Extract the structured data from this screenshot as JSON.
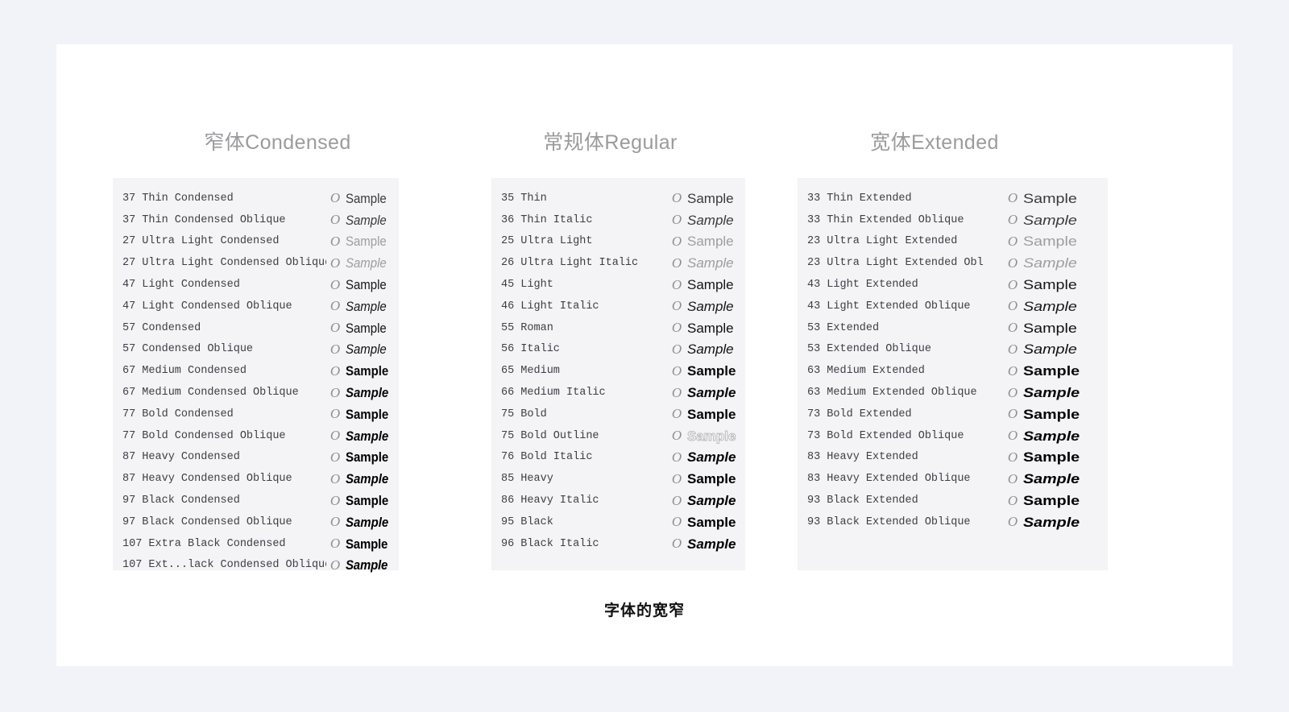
{
  "caption": "字体的宽窄",
  "glyph": "O",
  "colors": {
    "page_background": "#f2f3f8",
    "card_background": "#ffffff",
    "panel_background": "#f4f3f5",
    "heading": "#9b9b9e",
    "label": "#3c3f46",
    "glyph": "#8e8e93",
    "caption": "#111111"
  },
  "columns": [
    {
      "heading": "窄体Condensed",
      "rows": [
        {
          "number": "37",
          "name": "Thin Condensed",
          "sample": "Sample",
          "weight": "w-thin",
          "style": "",
          "width": "d-condensed"
        },
        {
          "number": "37",
          "name": "Thin Condensed Oblique",
          "sample": "Sample",
          "weight": "w-thin",
          "style": "s-italic",
          "width": "d-condensed"
        },
        {
          "number": "27",
          "name": "Ultra Light Condensed",
          "sample": "Sample",
          "weight": "w-ultra",
          "style": "",
          "width": "d-condensed"
        },
        {
          "number": "27",
          "name": "Ultra Light Condensed Oblique",
          "sample": "Sample",
          "weight": "w-ultra",
          "style": "s-italic",
          "width": "d-condensed"
        },
        {
          "number": "47",
          "name": "Light Condensed",
          "sample": "Sample",
          "weight": "w-light",
          "style": "",
          "width": "d-condensed"
        },
        {
          "number": "47",
          "name": "Light Condensed Oblique",
          "sample": "Sample",
          "weight": "w-light",
          "style": "s-italic",
          "width": "d-condensed"
        },
        {
          "number": "57",
          "name": "Condensed",
          "sample": "Sample",
          "weight": "w-regular",
          "style": "",
          "width": "d-condensed"
        },
        {
          "number": "57",
          "name": "Condensed Oblique",
          "sample": "Sample",
          "weight": "w-regular",
          "style": "s-italic",
          "width": "d-condensed"
        },
        {
          "number": "67",
          "name": "Medium Condensed",
          "sample": "Sample",
          "weight": "w-medium",
          "style": "",
          "width": "d-condensed"
        },
        {
          "number": "67",
          "name": "Medium Condensed Oblique",
          "sample": "Sample",
          "weight": "w-medium",
          "style": "s-italic",
          "width": "d-condensed"
        },
        {
          "number": "77",
          "name": "Bold Condensed",
          "sample": "Sample",
          "weight": "w-bold",
          "style": "",
          "width": "d-condensed"
        },
        {
          "number": "77",
          "name": "Bold Condensed Oblique",
          "sample": "Sample",
          "weight": "w-bold",
          "style": "s-italic",
          "width": "d-condensed"
        },
        {
          "number": "87",
          "name": "Heavy Condensed",
          "sample": "Sample",
          "weight": "w-heavy",
          "style": "",
          "width": "d-condensed"
        },
        {
          "number": "87",
          "name": "Heavy Condensed Oblique",
          "sample": "Sample",
          "weight": "w-heavy",
          "style": "s-italic",
          "width": "d-condensed"
        },
        {
          "number": "97",
          "name": "Black Condensed",
          "sample": "Sample",
          "weight": "w-black",
          "style": "",
          "width": "d-condensed"
        },
        {
          "number": "97",
          "name": "Black Condensed Oblique",
          "sample": "Sample",
          "weight": "w-black",
          "style": "s-italic",
          "width": "d-condensed"
        },
        {
          "number": "107",
          "name": "Extra Black Condensed",
          "sample": "Sample",
          "weight": "w-extrablack",
          "style": "",
          "width": "d-condensed"
        },
        {
          "number": "107",
          "name": "Ext...lack Condensed Oblique",
          "sample": "Sample",
          "weight": "w-extrablack",
          "style": "s-italic",
          "width": "d-condensed"
        }
      ]
    },
    {
      "heading": "常规体Regular",
      "rows": [
        {
          "number": "35",
          "name": "Thin",
          "sample": "Sample",
          "weight": "w-thin",
          "style": "",
          "width": ""
        },
        {
          "number": "36",
          "name": "Thin Italic",
          "sample": "Sample",
          "weight": "w-thin",
          "style": "s-italic",
          "width": ""
        },
        {
          "number": "25",
          "name": "Ultra Light",
          "sample": "Sample",
          "weight": "w-ultra",
          "style": "",
          "width": ""
        },
        {
          "number": "26",
          "name": "Ultra Light Italic",
          "sample": "Sample",
          "weight": "w-ultra",
          "style": "s-italic",
          "width": ""
        },
        {
          "number": "45",
          "name": "Light",
          "sample": "Sample",
          "weight": "w-light",
          "style": "",
          "width": ""
        },
        {
          "number": "46",
          "name": "Light Italic",
          "sample": "Sample",
          "weight": "w-light",
          "style": "s-italic",
          "width": ""
        },
        {
          "number": "55",
          "name": "Roman",
          "sample": "Sample",
          "weight": "w-regular",
          "style": "",
          "width": ""
        },
        {
          "number": "56",
          "name": "Italic",
          "sample": "Sample",
          "weight": "w-regular",
          "style": "s-italic",
          "width": ""
        },
        {
          "number": "65",
          "name": "Medium",
          "sample": "Sample",
          "weight": "w-medium",
          "style": "",
          "width": ""
        },
        {
          "number": "66",
          "name": "Medium Italic",
          "sample": "Sample",
          "weight": "w-medium",
          "style": "s-italic",
          "width": ""
        },
        {
          "number": "75",
          "name": "Bold",
          "sample": "Sample",
          "weight": "w-bold",
          "style": "",
          "width": ""
        },
        {
          "number": "75",
          "name": "Bold Outline",
          "sample": "Sample",
          "weight": "d-outline",
          "style": "",
          "width": ""
        },
        {
          "number": "76",
          "name": "Bold Italic",
          "sample": "Sample",
          "weight": "w-bold",
          "style": "s-italic",
          "width": ""
        },
        {
          "number": "85",
          "name": "Heavy",
          "sample": "Sample",
          "weight": "w-heavy",
          "style": "",
          "width": ""
        },
        {
          "number": "86",
          "name": "Heavy Italic",
          "sample": "Sample",
          "weight": "w-heavy",
          "style": "s-italic",
          "width": ""
        },
        {
          "number": "95",
          "name": "Black",
          "sample": "Sample",
          "weight": "w-black",
          "style": "",
          "width": ""
        },
        {
          "number": "96",
          "name": "Black Italic",
          "sample": "Sample",
          "weight": "w-black",
          "style": "s-italic",
          "width": ""
        }
      ]
    },
    {
      "heading": "宽体Extended",
      "rows": [
        {
          "number": "33",
          "name": "Thin Extended",
          "sample": "Sample",
          "weight": "w-thin",
          "style": "",
          "width": "d-extended"
        },
        {
          "number": "33",
          "name": "Thin Extended Oblique",
          "sample": "Sample",
          "weight": "w-thin",
          "style": "s-italic",
          "width": "d-extended"
        },
        {
          "number": "23",
          "name": "Ultra Light Extended",
          "sample": "Sample",
          "weight": "w-ultra",
          "style": "",
          "width": "d-extended"
        },
        {
          "number": "23",
          "name": "Ultra Light Extended Obl",
          "sample": "Sample",
          "weight": "w-ultra",
          "style": "s-italic",
          "width": "d-extended"
        },
        {
          "number": "43",
          "name": "Light Extended",
          "sample": "Sample",
          "weight": "w-light",
          "style": "",
          "width": "d-extended"
        },
        {
          "number": "43",
          "name": "Light Extended Oblique",
          "sample": "Sample",
          "weight": "w-light",
          "style": "s-italic",
          "width": "d-extended"
        },
        {
          "number": "53",
          "name": "Extended",
          "sample": "Sample",
          "weight": "w-regular",
          "style": "",
          "width": "d-extended"
        },
        {
          "number": "53",
          "name": "Extended Oblique",
          "sample": "Sample",
          "weight": "w-regular",
          "style": "s-italic",
          "width": "d-extended"
        },
        {
          "number": "63",
          "name": "Medium Extended",
          "sample": "Sample",
          "weight": "w-medium",
          "style": "",
          "width": "d-extended"
        },
        {
          "number": "63",
          "name": "Medium Extended Oblique",
          "sample": "Sample",
          "weight": "w-medium",
          "style": "s-italic",
          "width": "d-extended"
        },
        {
          "number": "73",
          "name": "Bold Extended",
          "sample": "Sample",
          "weight": "w-bold",
          "style": "",
          "width": "d-extended"
        },
        {
          "number": "73",
          "name": "Bold Extended Oblique",
          "sample": "Sample",
          "weight": "w-bold",
          "style": "s-italic",
          "width": "d-extended"
        },
        {
          "number": "83",
          "name": "Heavy Extended",
          "sample": "Sample",
          "weight": "w-heavy",
          "style": "",
          "width": "d-extended"
        },
        {
          "number": "83",
          "name": "Heavy Extended Oblique",
          "sample": "Sample",
          "weight": "w-heavy",
          "style": "s-italic",
          "width": "d-extended"
        },
        {
          "number": "93",
          "name": "Black Extended",
          "sample": "Sample",
          "weight": "w-black",
          "style": "",
          "width": "d-extended"
        },
        {
          "number": "93",
          "name": "Black Extended Oblique",
          "sample": "Sample",
          "weight": "w-black",
          "style": "s-italic",
          "width": "d-extended"
        }
      ]
    }
  ]
}
